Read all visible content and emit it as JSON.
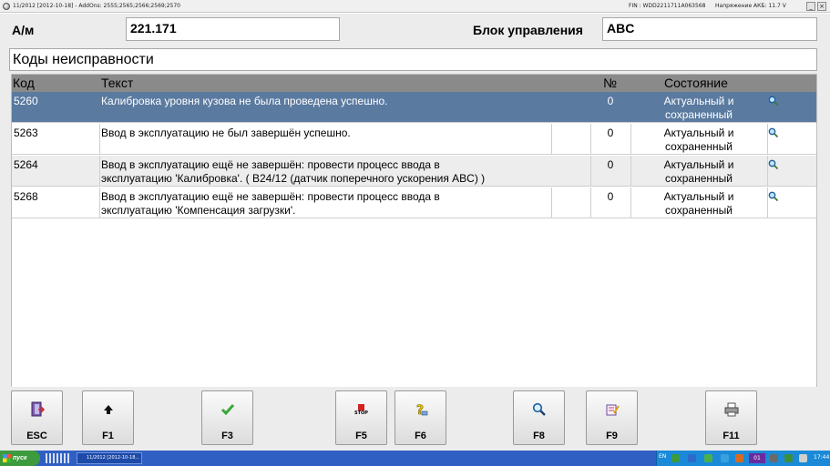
{
  "window": {
    "title": "11/2012 [2012-10-18] - AddOns: 2555;2565;2566;2569;2570",
    "fin": "FIN : WDD2211711A063568",
    "battery": "Напряжение АКБ: 11.7 V",
    "minimize": "_",
    "close": "×"
  },
  "vehicle": {
    "label": "А/м",
    "value": "221.171"
  },
  "control_unit": {
    "label": "Блок управления",
    "value": "ABC"
  },
  "section_title": "Коды неисправности",
  "table": {
    "headers": {
      "code": "Код",
      "text": "Текст",
      "number": "№",
      "state": "Состояние"
    },
    "rows": [
      {
        "code": "5260",
        "text_1": "Калибровка уровня кузова не была проведена успешно.",
        "text_2": "",
        "number": "0",
        "state_1": "Актуальный и",
        "state_2": "сохраненный"
      },
      {
        "code": "5263",
        "text_1": "Ввод в эксплуатацию не был завершён успешно.",
        "text_2": "",
        "number": "0",
        "state_1": "Актуальный и",
        "state_2": "сохраненный"
      },
      {
        "code": "5264",
        "text_1": "Ввод в эксплуатацию ещё не завершён: провести процесс ввода в",
        "text_2": "эксплуатацию 'Калибровка'. ( B24/12 (датчик поперечного ускорения ABC) )",
        "number": "0",
        "state_1": "Актуальный и",
        "state_2": "сохраненный"
      },
      {
        "code": "5268",
        "text_1": "Ввод в эксплуатацию ещё не завершён: провести процесс ввода в",
        "text_2": "эксплуатацию 'Компенсация загрузки'.",
        "number": "0",
        "state_1": "Актуальный и",
        "state_2": "сохраненный"
      }
    ]
  },
  "fkeys": {
    "esc": {
      "label": "ESC",
      "icon": "exit-door-icon"
    },
    "f1": {
      "label": "F1",
      "icon": "arrow-up-icon"
    },
    "f3": {
      "label": "F3",
      "icon": "checkmark-icon"
    },
    "f5": {
      "label": "F5",
      "icon": "stop-icon",
      "icon_text": "STOP"
    },
    "f6": {
      "label": "F6",
      "icon": "help-icon"
    },
    "f8": {
      "label": "F8",
      "icon": "magnifier-icon"
    },
    "f9": {
      "label": "F9",
      "icon": "notepad-icon"
    },
    "f11": {
      "label": "F11",
      "icon": "printer-icon"
    }
  },
  "taskbar": {
    "start_label": "пуск",
    "task_label": "11/2012 [2012-10-18...",
    "lang": "EN",
    "badge": "01",
    "clock": "17:44"
  },
  "colors": {
    "selected_row": "#5a7aa0",
    "header": "#8a8a8a",
    "check_green": "#3aa63a",
    "stop_red": "#d22222",
    "taskbar": "#2f5fc2"
  }
}
